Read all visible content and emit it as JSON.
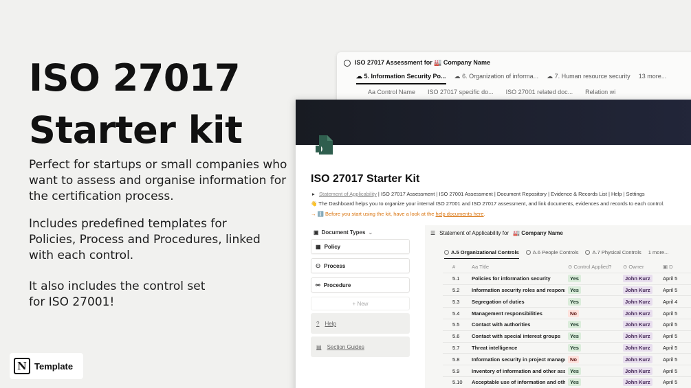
{
  "hero": {
    "title_line1": "ISO 27017",
    "title_line2": "Starter kit",
    "p1_l1": "Perfect for startups or small companies who",
    "p1_l2": "want to assess and organise information for",
    "p1_l3": "the certification process.",
    "p2_l1": "Includes predefined templates for",
    "p2_l2": "Policies, Process and Procedures, linked",
    "p2_l3": "with each control.",
    "p3_l1": "It also includes the control set",
    "p3_l2": "for ISO 27001!"
  },
  "badge": {
    "logo": "N",
    "label": "Template"
  },
  "back_window": {
    "title": "ISO 27017 Assessment for 🏭 Company Name",
    "tabs": [
      "5. Information Security Po...",
      "6. Organization of informa...",
      "7. Human resource security",
      "13 more..."
    ],
    "columns": [
      "Aa Control Name",
      "ISO 27017 specific do...",
      "ISO 27001 related doc...",
      "Relation wi"
    ]
  },
  "page": {
    "title": "ISO 27017 Starter Kit",
    "breadcrumb_first": "Statement of Applicability",
    "breadcrumb_rest": " | ISO 27017 Assessment | ISO 27001 Assessment | Document Repository | Evidence & Records List | Help | Settings",
    "intro": "👋 The Dashboard helps you to organize your internal ISO 27001 and ISO 27017 assessment, and link documents, evidences and records to each control.",
    "note_prefix": "→ ℹ️ Before you start using the kit, have a look at the ",
    "note_link": "help documents here",
    "note_suffix": "."
  },
  "sidebar": {
    "header": "Document Types",
    "items": [
      "Policy",
      "Process",
      "Procedure"
    ],
    "new_label": "+ New",
    "gray_items": [
      "Help",
      "Section Guides"
    ]
  },
  "soa": {
    "title_prefix": "Statement of Applicability for",
    "title_company": "🏭 Company Name",
    "tabs": [
      "A.5 Organizational Controls",
      "A.6 People Controls",
      "A.7 Physical Controls",
      "1 more..."
    ],
    "headers": [
      "#",
      "Aa Title",
      "Control Applied?",
      "Owner",
      "D"
    ],
    "rows": [
      {
        "num": "5.1",
        "title": "Policies for information security",
        "applied": "Yes",
        "owner": "John Kurz",
        "date": "April 5"
      },
      {
        "num": "5.2",
        "title": "Information security roles and responsib",
        "applied": "Yes",
        "owner": "John Kurz",
        "date": "April 5"
      },
      {
        "num": "5.3",
        "title": "Segregation of duties",
        "applied": "Yes",
        "owner": "John Kurz",
        "date": "April 4"
      },
      {
        "num": "5.4",
        "title": "Management responsibilities",
        "applied": "No",
        "owner": "John Kurz",
        "date": "April 5"
      },
      {
        "num": "5.5",
        "title": "Contact with authorities",
        "applied": "Yes",
        "owner": "John Kurz",
        "date": "April 5"
      },
      {
        "num": "5.6",
        "title": "Contact with special interest groups",
        "applied": "Yes",
        "owner": "John Kurz",
        "date": "April 5"
      },
      {
        "num": "5.7",
        "title": "Threat intelligence",
        "applied": "Yes",
        "owner": "John Kurz",
        "date": "April 5"
      },
      {
        "num": "5.8",
        "title": "Information security in project managem",
        "applied": "No",
        "owner": "John Kurz",
        "date": "April 5"
      },
      {
        "num": "5.9",
        "title": "Inventory of information and other assoc",
        "applied": "Yes",
        "owner": "John Kurz",
        "date": "April 5"
      },
      {
        "num": "5.10",
        "title": "Acceptable use of information and other",
        "applied": "Yes",
        "owner": "John Kurz",
        "date": "April 5"
      }
    ]
  },
  "colors": {
    "cover": "#181b22",
    "icon_green": "#2f5e4e",
    "warning_orange": "#d9730d"
  }
}
